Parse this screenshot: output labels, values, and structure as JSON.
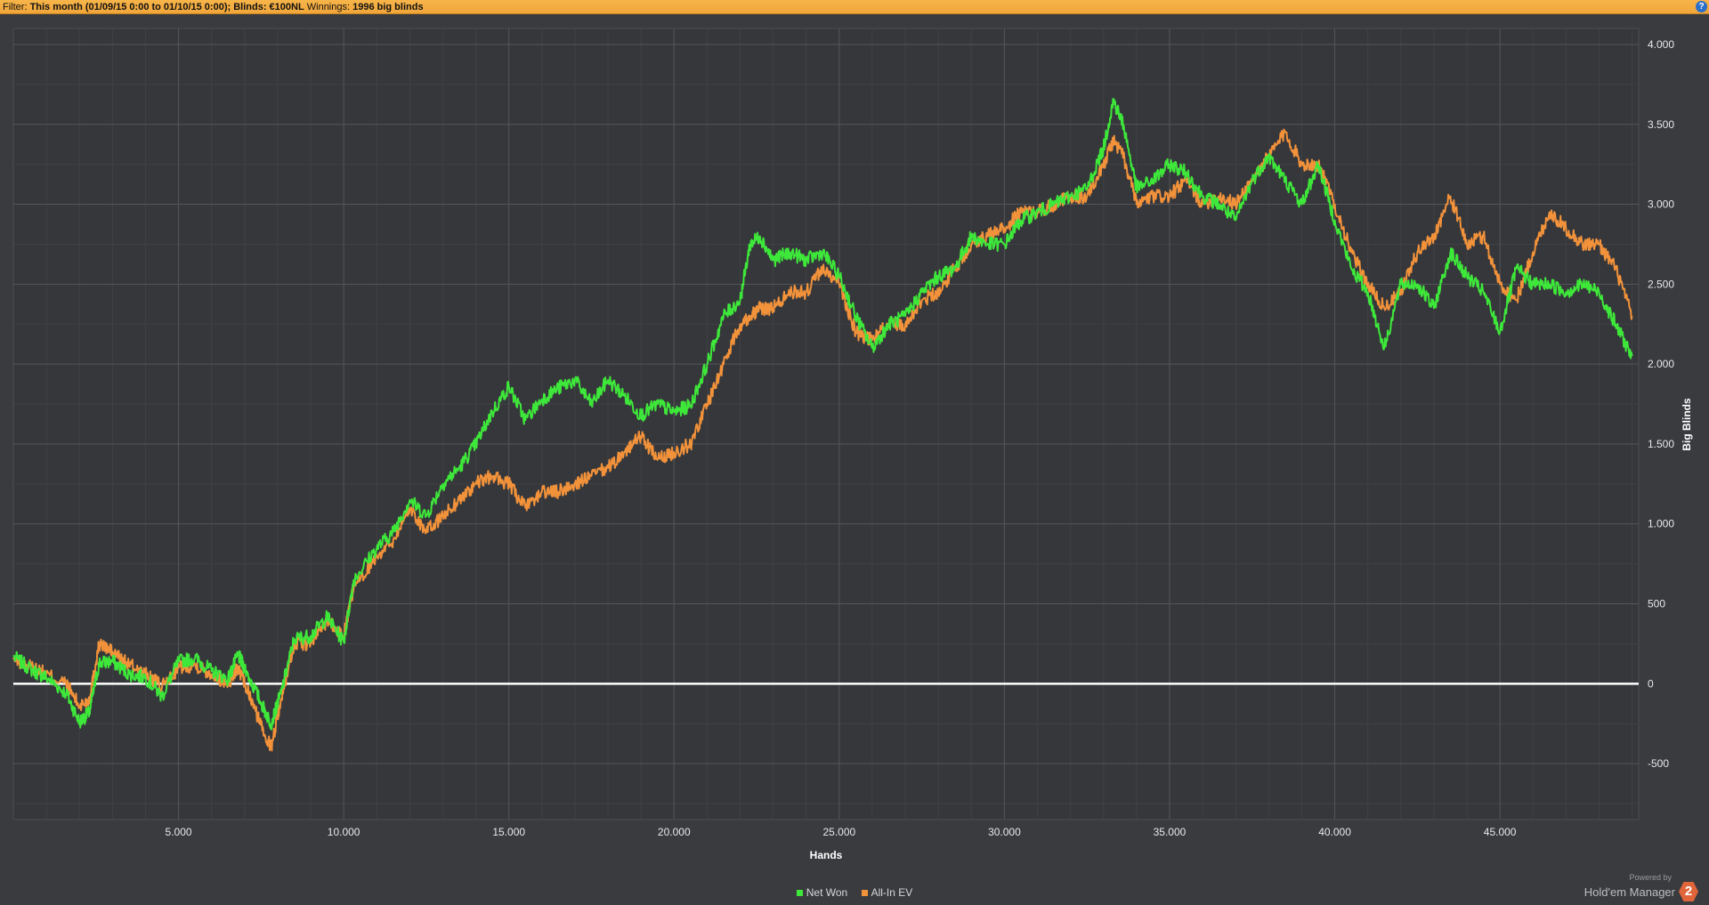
{
  "filter": {
    "prefix": "Filter: ",
    "text": "This month (01/09/15 0:00 to 01/10/15 0:00); Blinds: €100NL",
    "winnings_label": " Winnings: ",
    "winnings_value": "1996 big blinds",
    "help_icon": "help-icon"
  },
  "chart_data": {
    "type": "line",
    "title": "",
    "xlabel": "Hands",
    "ylabel": "Big Blinds",
    "xlim": [
      0,
      49200
    ],
    "ylim": [
      -850,
      4100
    ],
    "x_ticks": [
      5000,
      10000,
      15000,
      20000,
      25000,
      30000,
      35000,
      40000,
      45000
    ],
    "x_tick_labels": [
      "5.000",
      "10.000",
      "15.000",
      "20.000",
      "25.000",
      "30.000",
      "35.000",
      "40.000",
      "45.000"
    ],
    "y_ticks": [
      -500,
      0,
      500,
      1000,
      1500,
      2000,
      2500,
      3000,
      3500,
      4000
    ],
    "y_tick_labels": [
      "-500",
      "0",
      "500",
      "1.000",
      "1.500",
      "2.000",
      "2.500",
      "3.000",
      "3.500",
      "4.000"
    ],
    "grid": true,
    "legend_position": "bottom-center",
    "background": "#3a3b3f",
    "series": [
      {
        "name": "Net Won",
        "color": "#3ee83a",
        "x": [
          0,
          600,
          1000,
          1600,
          2000,
          2300,
          2600,
          3000,
          3500,
          4000,
          4500,
          5000,
          5500,
          6000,
          6500,
          6800,
          7000,
          7500,
          7800,
          8100,
          8500,
          9000,
          9500,
          10000,
          10300,
          11000,
          11500,
          12000,
          12500,
          13000,
          13500,
          14000,
          14500,
          15000,
          15500,
          16000,
          16500,
          17000,
          17500,
          18000,
          18500,
          19000,
          19500,
          20000,
          20500,
          21000,
          21500,
          22000,
          22300,
          22600,
          23000,
          23500,
          24000,
          24500,
          25000,
          25500,
          26000,
          26500,
          27000,
          27500,
          28000,
          28500,
          29000,
          29500,
          30000,
          30500,
          31000,
          31500,
          32000,
          32500,
          33000,
          33300,
          33600,
          34000,
          34500,
          35000,
          35500,
          36000,
          36500,
          37000,
          37500,
          38000,
          38500,
          39000,
          39500,
          40000,
          40500,
          41000,
          41500,
          42000,
          42500,
          43000,
          43500,
          44000,
          44500,
          45000,
          45500,
          46000,
          46500,
          47000,
          47500,
          48000,
          48500,
          49000
        ],
        "values": [
          170,
          80,
          40,
          -60,
          -240,
          -180,
          130,
          140,
          60,
          40,
          -80,
          140,
          160,
          80,
          30,
          180,
          100,
          -120,
          -250,
          -60,
          280,
          300,
          420,
          260,
          650,
          850,
          950,
          1150,
          1050,
          1250,
          1350,
          1500,
          1700,
          1860,
          1650,
          1780,
          1850,
          1900,
          1750,
          1900,
          1800,
          1680,
          1750,
          1700,
          1740,
          2000,
          2300,
          2400,
          2750,
          2800,
          2650,
          2700,
          2650,
          2700,
          2550,
          2300,
          2100,
          2250,
          2300,
          2450,
          2550,
          2600,
          2800,
          2750,
          2750,
          2900,
          2950,
          3000,
          3050,
          3100,
          3350,
          3650,
          3500,
          3100,
          3150,
          3250,
          3200,
          3050,
          3000,
          2900,
          3150,
          3300,
          3150,
          3000,
          3250,
          2900,
          2600,
          2450,
          2100,
          2500,
          2500,
          2350,
          2700,
          2550,
          2450,
          2200,
          2600,
          2500,
          2500,
          2450,
          2500,
          2450,
          2250,
          2050
        ]
      },
      {
        "name": "All-In EV",
        "color": "#f2923a",
        "x": [
          0,
          600,
          1000,
          1600,
          2000,
          2300,
          2600,
          3000,
          3500,
          4000,
          4500,
          5000,
          5500,
          6000,
          6500,
          6800,
          7000,
          7500,
          7800,
          8100,
          8500,
          9000,
          9500,
          10000,
          10300,
          11000,
          11500,
          12000,
          12500,
          13000,
          13500,
          14000,
          14500,
          15000,
          15500,
          16000,
          16500,
          17000,
          17500,
          18000,
          18500,
          19000,
          19500,
          20000,
          20500,
          21000,
          21500,
          22000,
          22300,
          22600,
          23000,
          23500,
          24000,
          24500,
          25000,
          25500,
          26000,
          26500,
          27000,
          27500,
          28000,
          28500,
          29000,
          29500,
          30000,
          30500,
          31000,
          31500,
          32000,
          32500,
          33000,
          33300,
          33600,
          34000,
          34500,
          35000,
          35500,
          36000,
          36500,
          37000,
          37500,
          38000,
          38500,
          39000,
          39500,
          40000,
          40500,
          41000,
          41500,
          42000,
          42500,
          43000,
          43500,
          44000,
          44500,
          45000,
          45500,
          46000,
          46500,
          47000,
          47500,
          48000,
          48500,
          49000
        ],
        "values": [
          150,
          100,
          60,
          0,
          -140,
          -100,
          250,
          200,
          120,
          60,
          -20,
          100,
          120,
          60,
          0,
          100,
          0,
          -260,
          -400,
          -100,
          250,
          250,
          400,
          300,
          600,
          800,
          900,
          1100,
          950,
          1050,
          1150,
          1250,
          1300,
          1250,
          1100,
          1200,
          1200,
          1250,
          1300,
          1350,
          1450,
          1550,
          1400,
          1450,
          1500,
          1750,
          2000,
          2250,
          2300,
          2350,
          2350,
          2450,
          2450,
          2600,
          2500,
          2200,
          2150,
          2250,
          2250,
          2400,
          2450,
          2600,
          2750,
          2800,
          2850,
          2950,
          2950,
          3000,
          3050,
          3050,
          3250,
          3400,
          3300,
          3000,
          3050,
          3050,
          3150,
          3000,
          3050,
          3000,
          3150,
          3300,
          3450,
          3250,
          3250,
          3000,
          2700,
          2500,
          2350,
          2450,
          2700,
          2800,
          3050,
          2750,
          2800,
          2500,
          2400,
          2700,
          2950,
          2850,
          2750,
          2750,
          2600,
          2300
        ]
      }
    ],
    "zero_line_color": "#ffffff"
  },
  "legend": [
    {
      "label": "Net Won",
      "color": "#3ee83a"
    },
    {
      "label": "All-In EV",
      "color": "#f2923a"
    }
  ],
  "brand": {
    "powered": "Powered by",
    "name": "Hold'em Manager",
    "logo": "2"
  }
}
